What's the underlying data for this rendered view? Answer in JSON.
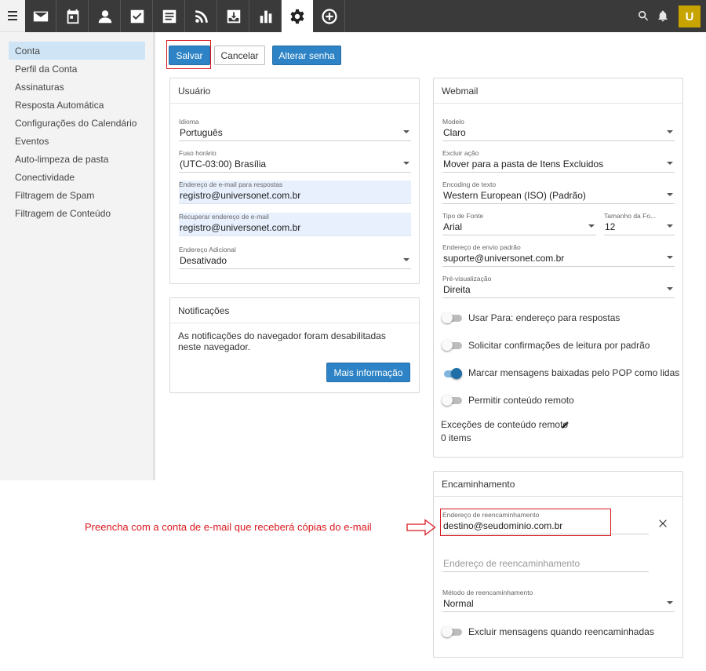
{
  "colors": {
    "accent": "#2d83c5",
    "topbar": "#3a3a3a",
    "highlight_red": "#d9181f",
    "avatar": "#c8a400",
    "sidebar_active": "#cfe5f5"
  },
  "topbar": {
    "nav_icons": [
      "mail-icon",
      "calendar-icon",
      "contacts-icon",
      "tasks-icon",
      "notes-icon",
      "feeds-icon",
      "archive-icon",
      "reports-icon",
      "settings-icon",
      "add-icon"
    ],
    "avatar_letter": "U"
  },
  "sidebar": {
    "items": [
      {
        "label": "Conta"
      },
      {
        "label": "Perfil da Conta"
      },
      {
        "label": "Assinaturas"
      },
      {
        "label": "Resposta Automática"
      },
      {
        "label": "Configurações do Calendário"
      },
      {
        "label": "Eventos"
      },
      {
        "label": "Auto-limpeza de pasta"
      },
      {
        "label": "Conectividade"
      },
      {
        "label": "Filtragem de Spam"
      },
      {
        "label": "Filtragem de Conteúdo"
      }
    ]
  },
  "toolbar": {
    "save": "Salvar",
    "cancel": "Cancelar",
    "change_password": "Alterar senha"
  },
  "usuario": {
    "title": "Usuário",
    "idioma_label": "Idioma",
    "idioma_value": "Português",
    "fuso_label": "Fuso horário",
    "fuso_value": "(UTC-03:00) Brasília",
    "reply_label": "Endereço de e-mail para respostas",
    "reply_value": "registro@universonet.com.br",
    "recover_label": "Recuperar endereço de e-mail",
    "recover_value": "registro@universonet.com.br",
    "extra_label": "Endereço Adicional",
    "extra_value": "Desativado"
  },
  "notificacoes": {
    "title": "Notificações",
    "message": "As notificações do navegador foram desabilitadas neste navegador.",
    "more_button": "Mais informação"
  },
  "webmail": {
    "title": "Webmail",
    "modelo_label": "Modelo",
    "modelo_value": "Claro",
    "excluir_label": "Excluir ação",
    "excluir_value": "Mover para a pasta de Itens Excluidos",
    "encoding_label": "Encoding de texto",
    "encoding_value": "Western European (ISO) (Padrão)",
    "fonte_label": "Tipo de Fonte",
    "fonte_value": "Arial",
    "tamanho_label": "Tamanho da Fo...",
    "tamanho_value": "12",
    "envio_label": "Endereço de envio padrão",
    "envio_value": "suporte@universonet.com.br",
    "preview_label": "Pré-visualização",
    "preview_value": "Direita",
    "toggles": [
      {
        "label": "Usar Para: endereço para respostas",
        "on": false
      },
      {
        "label": "Solicitar confirmações de leitura por padrão",
        "on": false
      },
      {
        "label": "Marcar mensagens baixadas pelo POP como lidas",
        "on": true
      },
      {
        "label": "Permitir conteúdo remoto",
        "on": false
      }
    ],
    "exceptions_label": "Exceções de conteúdo remoto",
    "exceptions_count": "0 items"
  },
  "encaminhamento": {
    "title": "Encaminhamento",
    "addr_label": "Endereço de reencaminhamento",
    "addr_value": "destino@seudominio.com.br",
    "addr2_placeholder": "Endereço de reencaminhamento",
    "method_label": "Método de reencaminhamento",
    "method_value": "Normal",
    "delete_toggle_label": "Excluir mensagens quando reencaminhadas",
    "delete_toggle_on": false
  },
  "annotation": {
    "text": "Preencha com a conta de e-mail que receberá cópias do e-mail"
  }
}
